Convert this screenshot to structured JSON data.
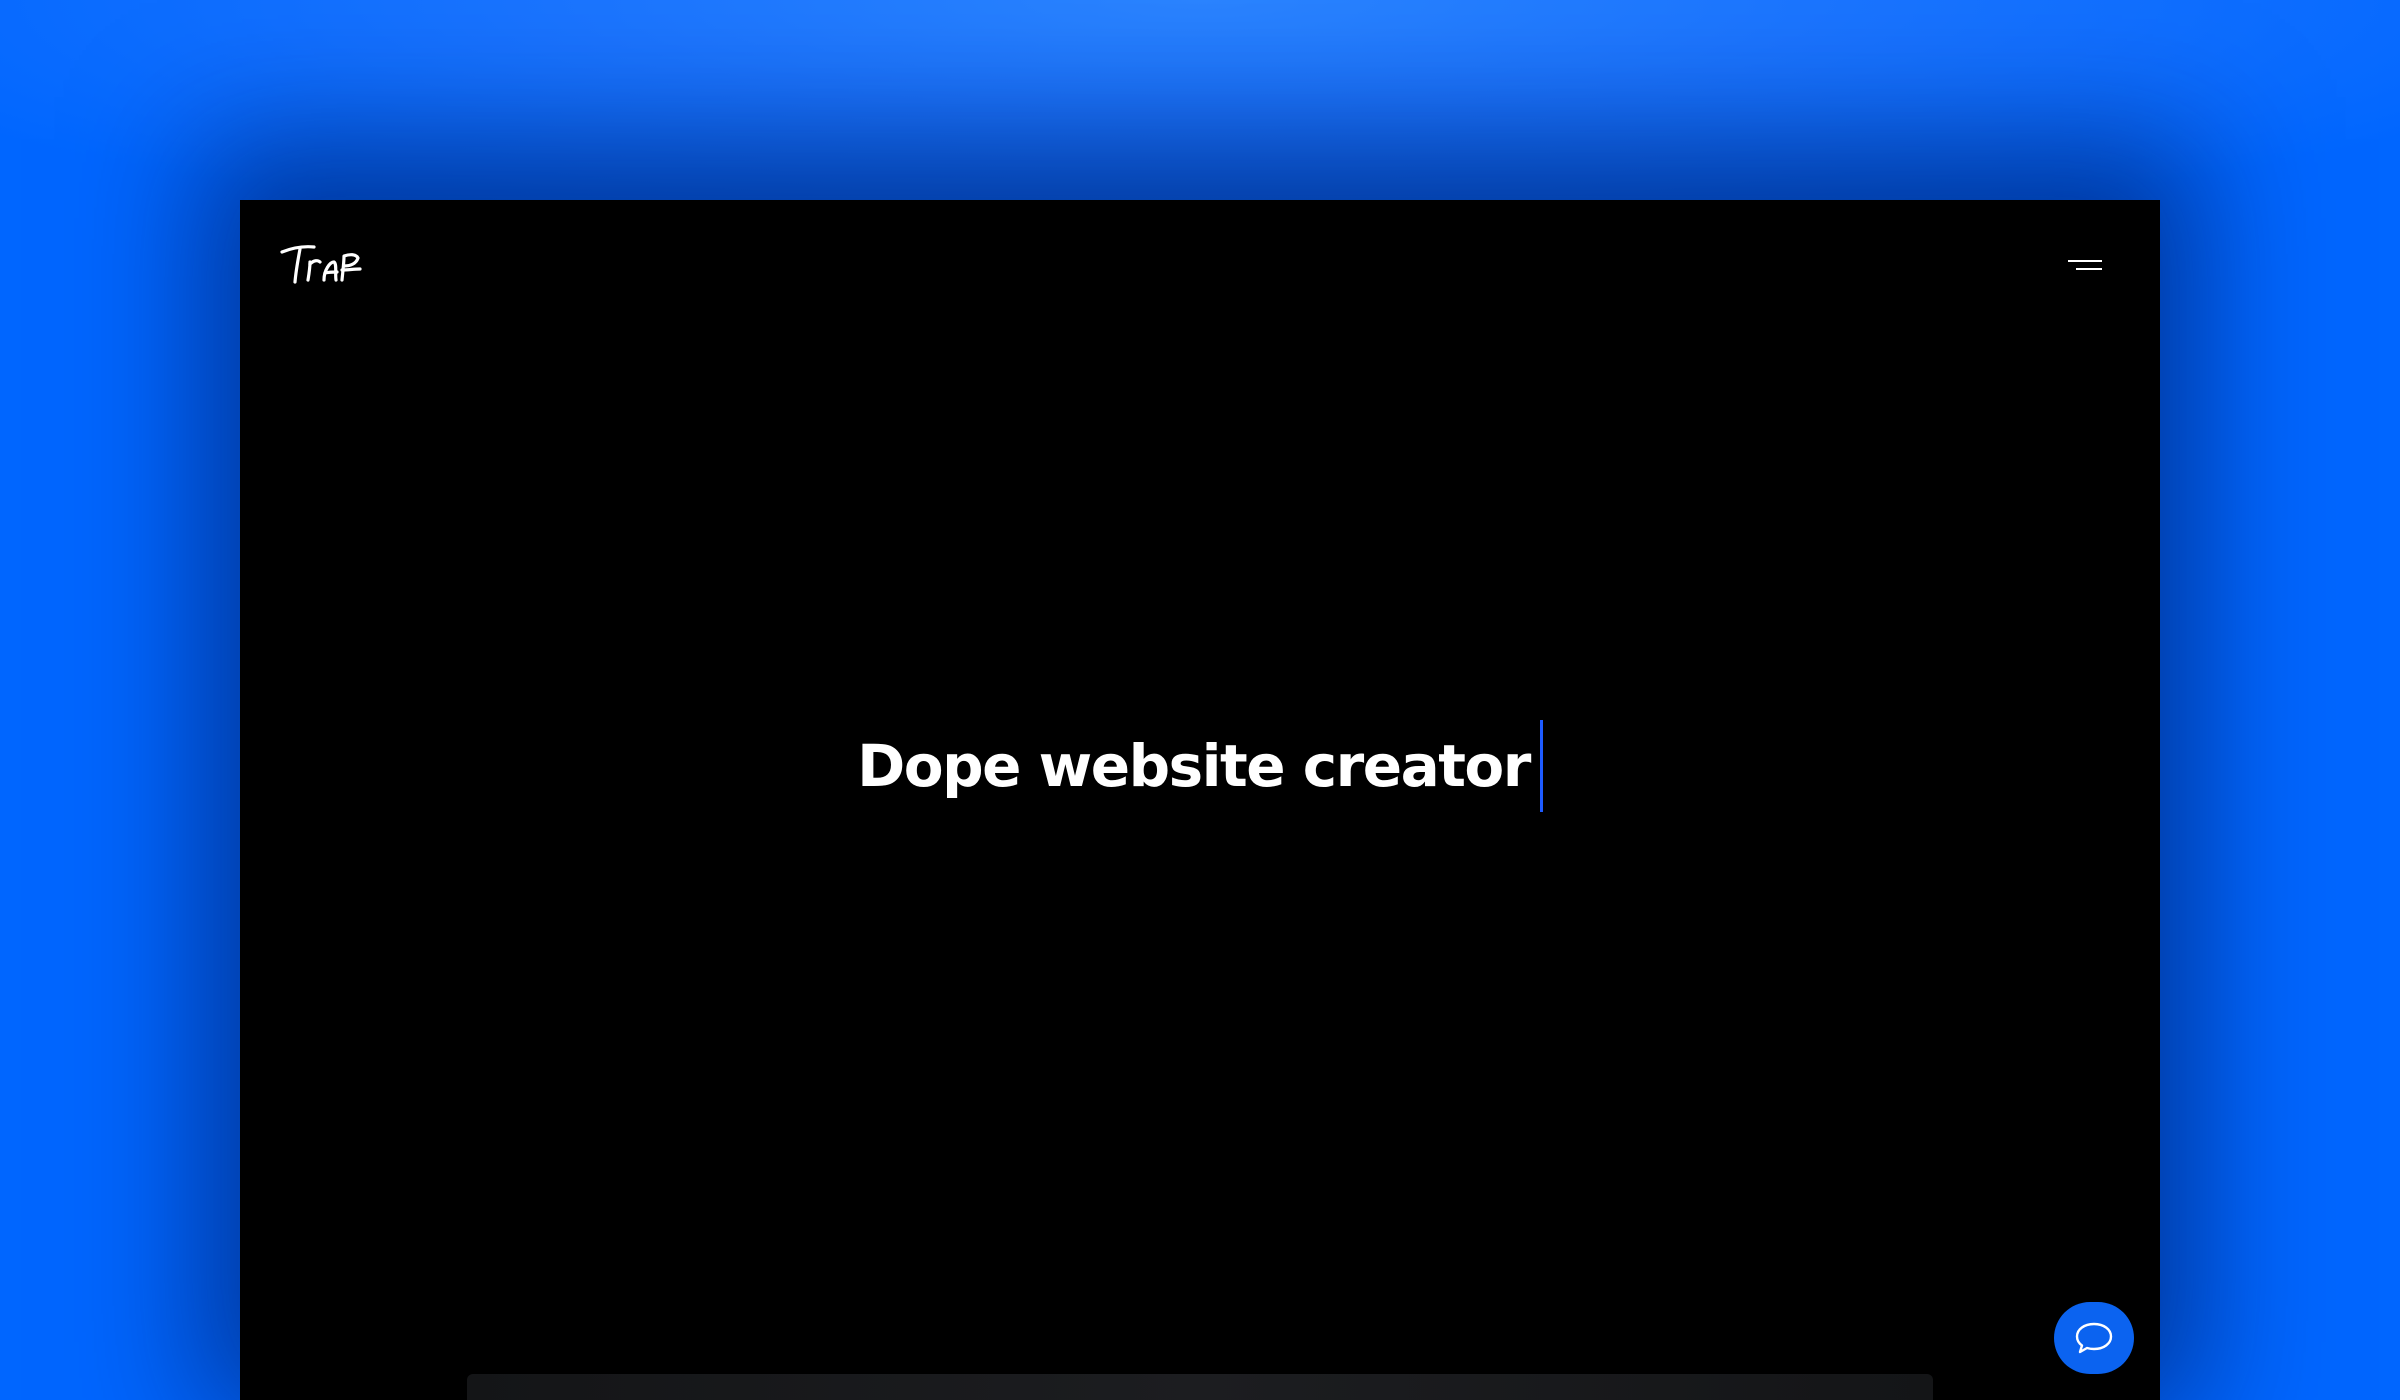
{
  "background": {
    "accent": "#0066ff"
  },
  "header": {
    "logo_text": "Traf",
    "menu_icon": "hamburger-menu-icon"
  },
  "hero": {
    "title": "Dope website creator",
    "caret_color": "#1e5bff"
  },
  "chat": {
    "icon": "chat-bubble-icon",
    "color": "#0b63f0"
  }
}
